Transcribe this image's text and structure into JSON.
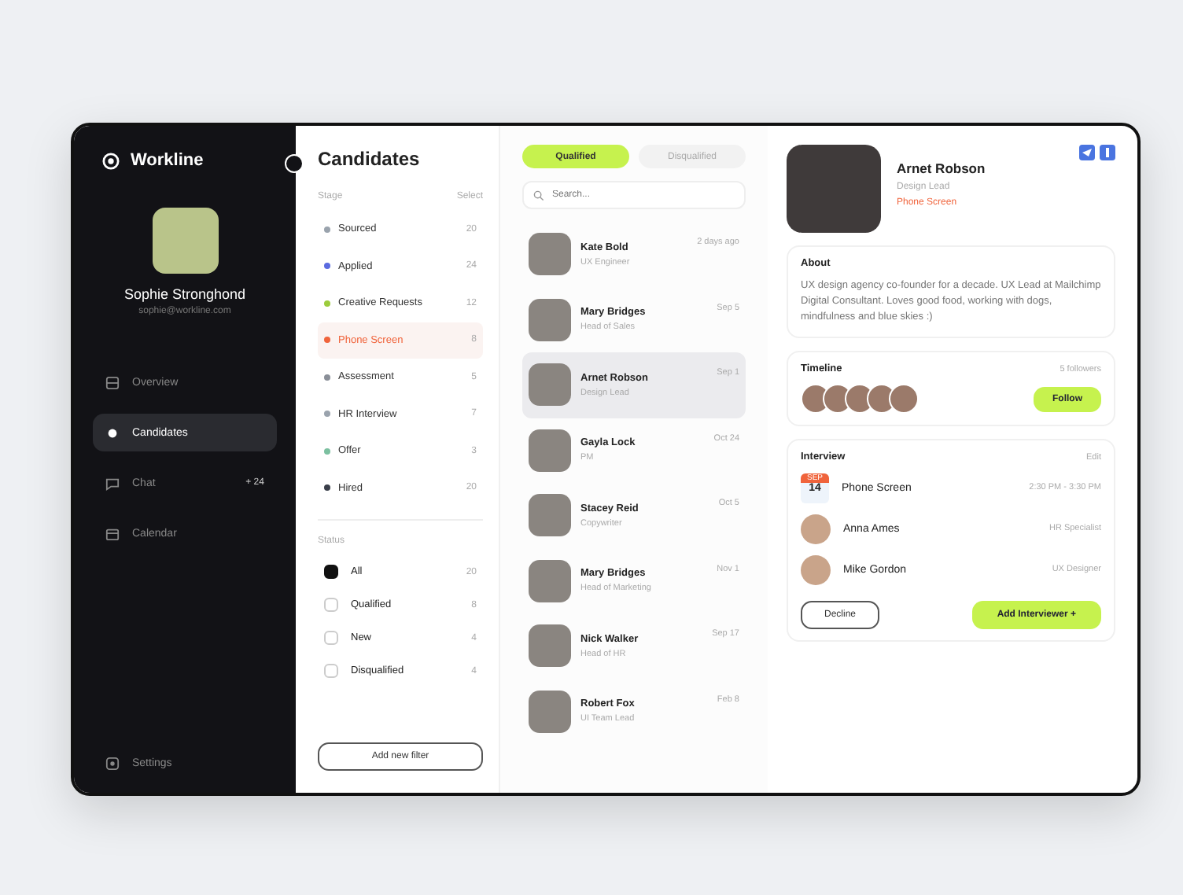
{
  "sidebar": {
    "logo": "Workline",
    "user": {
      "name": "Sophie Stronghond",
      "email": "sophie@workline.com"
    },
    "nav": [
      {
        "label": "Overview",
        "selected": false
      },
      {
        "label": "Candidates",
        "selected": true
      },
      {
        "label": "Chat",
        "selected": false,
        "badge": "+ 24"
      },
      {
        "label": "Calendar",
        "selected": false
      }
    ],
    "settings": "Settings"
  },
  "filters": {
    "title": "Candidates",
    "stage_label": "Stage",
    "stage_action": "Select",
    "stages": [
      {
        "label": "Sourced",
        "count": "20",
        "color": "#9aa3ad",
        "selected": false
      },
      {
        "label": "Applied",
        "count": "24",
        "color": "#5b6be0",
        "selected": false
      },
      {
        "label": "Creative Requests",
        "count": "12",
        "color": "#9ccc3c",
        "selected": false
      },
      {
        "label": "Phone Screen",
        "count": "8",
        "color": "#f0643c",
        "selected": true
      },
      {
        "label": "Assessment",
        "count": "5",
        "color": "#8a8f98",
        "selected": false
      },
      {
        "label": "HR Interview",
        "count": "7",
        "color": "#9aa3ad",
        "selected": false
      },
      {
        "label": "Offer",
        "count": "3",
        "color": "#7cc0a0",
        "selected": false
      },
      {
        "label": "Hired",
        "count": "20",
        "color": "#3a3f4a",
        "selected": false
      }
    ],
    "status_label": "Status",
    "statuses": [
      {
        "label": "All",
        "count": "20",
        "checked": true
      },
      {
        "label": "Qualified",
        "count": "8",
        "checked": false
      },
      {
        "label": "New",
        "count": "4",
        "checked": false
      },
      {
        "label": "Disqualified",
        "count": "4",
        "checked": false
      }
    ],
    "add_button": "Add new filter"
  },
  "list": {
    "tabs": [
      {
        "label": "Qualified",
        "selected": true
      },
      {
        "label": "Disqualified",
        "selected": false
      }
    ],
    "search": {
      "placeholder": "Search..."
    },
    "candidates": [
      {
        "name": "Kate Bold",
        "role": "UX Engineer",
        "date": "2 days ago",
        "selected": false
      },
      {
        "name": "Mary Bridges",
        "role": "Head of Sales",
        "date": "Sep 5",
        "selected": false
      },
      {
        "name": "Arnet Robson",
        "role": "Design Lead",
        "date": "Sep 1",
        "selected": true
      },
      {
        "name": "Gayla Lock",
        "role": "PM",
        "date": "Oct 24",
        "selected": false
      },
      {
        "name": "Stacey Reid",
        "role": "Copywriter",
        "date": "Oct 5",
        "selected": false
      },
      {
        "name": "Mary Bridges",
        "role": "Head of Marketing",
        "date": "Nov 1",
        "selected": false
      },
      {
        "name": "Nick Walker",
        "role": "Head of HR",
        "date": "Sep 17",
        "selected": false
      },
      {
        "name": "Robert Fox",
        "role": "UI Team Lead",
        "date": "Feb 8",
        "selected": false
      }
    ]
  },
  "profile": {
    "name": "Arnet Robson",
    "role": "Design Lead",
    "stage": "Phone Screen",
    "about": {
      "title": "About",
      "text": "UX design agency co-founder for a decade. UX Lead at Mailchimp Digital Consultant. Loves good food, working with dogs, mindfulness and blue skies :)"
    },
    "timeline": {
      "title": "Timeline",
      "followers": "5 followers",
      "follow_button": "Follow"
    },
    "interview": {
      "title": "Interview",
      "action": "Edit",
      "month": "SEP",
      "day": "14",
      "event": "Phone Screen",
      "time": "2:30 PM - 3:30 PM",
      "interviewers": [
        {
          "name": "Anna Ames",
          "role": "HR Specialist"
        },
        {
          "name": "Mike Gordon",
          "role": "UX Designer"
        }
      ],
      "decline_button": "Decline",
      "add_button": "Add Interviewer +"
    }
  }
}
